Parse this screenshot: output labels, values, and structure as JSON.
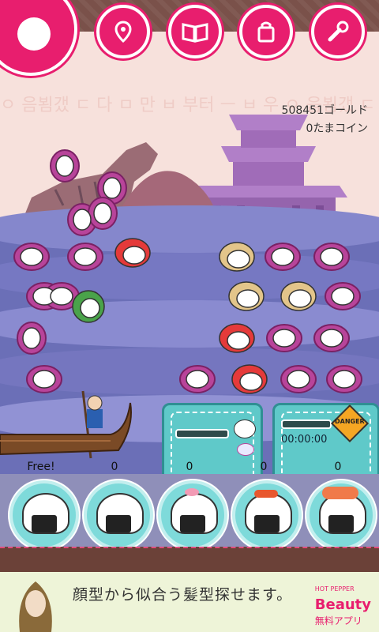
{
  "currency": {
    "gold_text": "508451ゴールド",
    "coin_text": "0たまコイン"
  },
  "top_buttons": [
    {
      "name": "map-pin-icon"
    },
    {
      "name": "book-icon"
    },
    {
      "name": "bag-icon"
    },
    {
      "name": "wrench-icon"
    }
  ],
  "timer": {
    "value": "00:00:00",
    "warning_label": "DANGER"
  },
  "slots": [
    {
      "count": "Free!"
    },
    {
      "count": "0"
    },
    {
      "count": "0"
    },
    {
      "count": "0"
    },
    {
      "count": "0"
    }
  ],
  "ad": {
    "headline": "顔型から似合う髪型探せます。",
    "brand_top": "HOT PEPPER",
    "brand_name": "Beauty",
    "brand_sub": "無料アプリ"
  },
  "colors": {
    "accent": "#e81e6e",
    "panel": "#5fc9c9",
    "water": "#6b6fb7"
  }
}
